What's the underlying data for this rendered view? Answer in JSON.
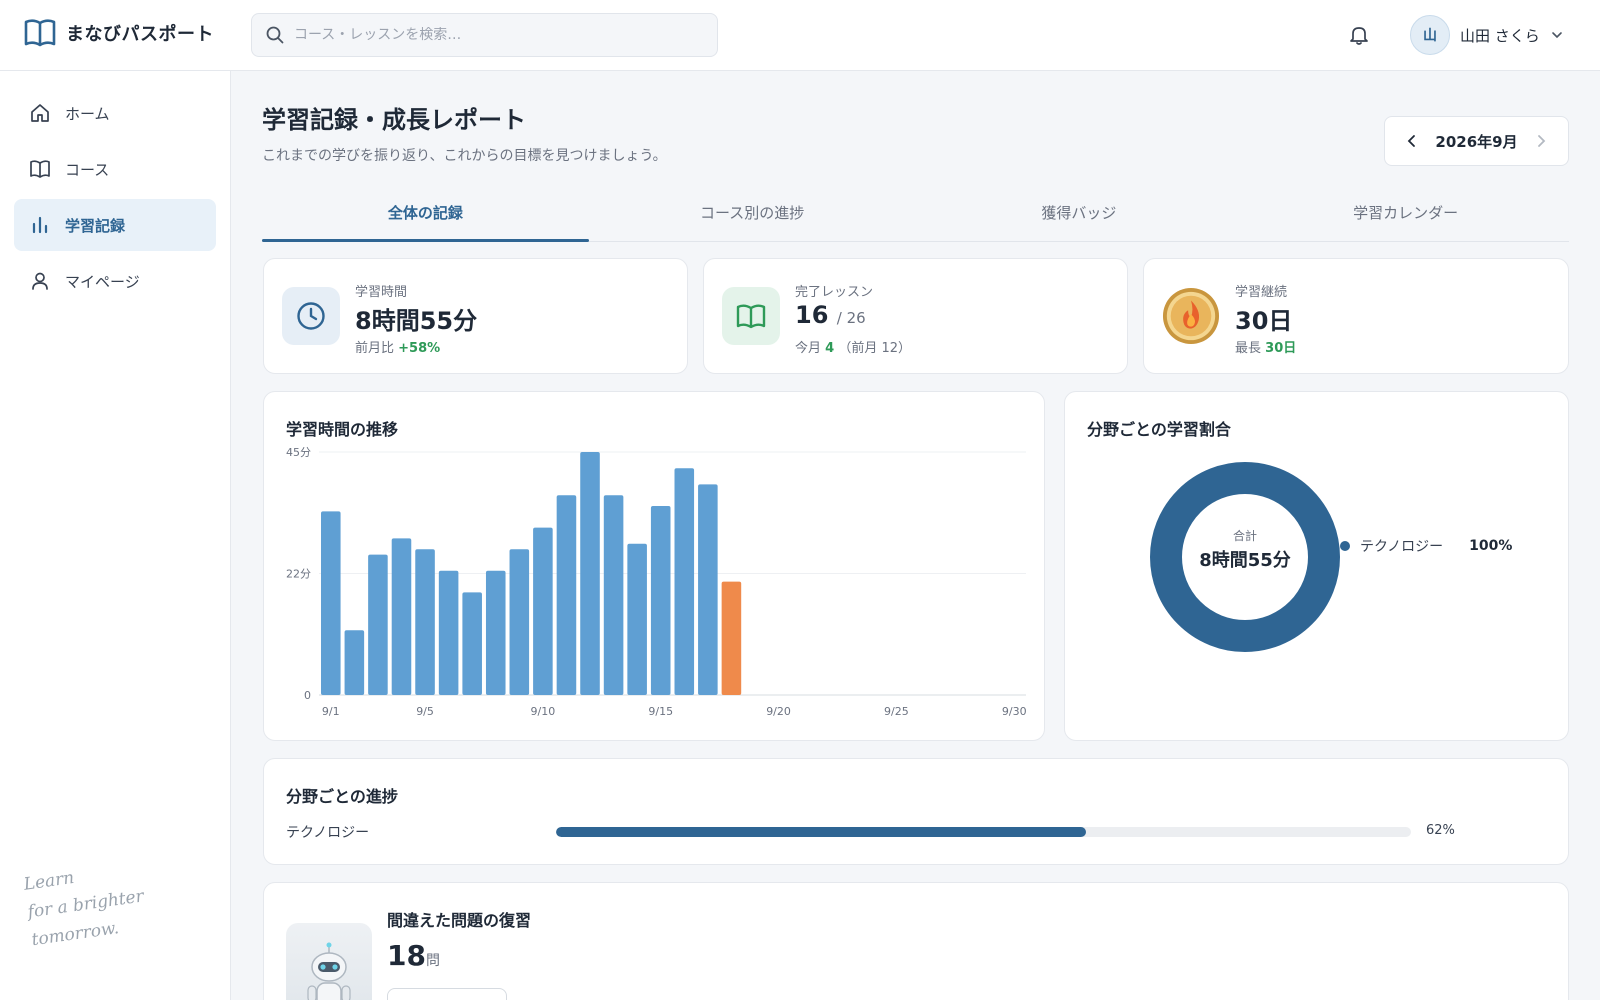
{
  "app": {
    "name": "まなびパスポート"
  },
  "search": {
    "placeholder": "コース・レッスンを検索…"
  },
  "user": {
    "avatar": "山",
    "name": "山田 さくら"
  },
  "sidebar": {
    "items": [
      {
        "label": "ホーム",
        "icon": "home-icon",
        "active": false
      },
      {
        "label": "コース",
        "icon": "book-icon",
        "active": false
      },
      {
        "label": "学習記録",
        "icon": "bar-chart-icon",
        "active": true
      },
      {
        "label": "マイページ",
        "icon": "user-icon",
        "active": false
      }
    ],
    "tagline_lines": [
      "Learn",
      "for a brighter",
      "tomorrow."
    ]
  },
  "page": {
    "title": "学習記録・成長レポート",
    "subtitle": "これまでの学びを振り返り、これからの目標を見つけましょう。",
    "month": "2026年9月"
  },
  "tabs": [
    {
      "label": "全体の記録",
      "active": true
    },
    {
      "label": "コース別の進捗",
      "active": false
    },
    {
      "label": "獲得バッジ",
      "active": false
    },
    {
      "label": "学習カレンダー",
      "active": false
    }
  ],
  "stats": {
    "time": {
      "label": "学習時間",
      "value": "8時間55分",
      "note_prefix": "前月比",
      "note_value": "+58%"
    },
    "lessons": {
      "label": "完了レッスン",
      "value": "16",
      "total": "/ 26",
      "note_prefix": "今月",
      "note_value": "4",
      "note_suffix": "（前月 12）"
    },
    "streak": {
      "label": "学習継続",
      "value": "30日",
      "note_prefix": "最長",
      "note_value": "30日"
    }
  },
  "colors": {
    "primary": "#2f6593",
    "bar": "#5f9fd3",
    "bar_today": "#ef8a4b",
    "positive": "#2e9a58"
  },
  "chart_data": [
    {
      "type": "bar",
      "title": "学習時間の推移",
      "x": [
        1,
        2,
        3,
        4,
        5,
        6,
        7,
        8,
        9,
        10,
        11,
        12,
        13,
        14,
        15,
        16,
        17,
        18
      ],
      "values": [
        34,
        12,
        26,
        29,
        27,
        23,
        19,
        23,
        27,
        31,
        37,
        45,
        37,
        28,
        35,
        42,
        39,
        21
      ],
      "highlight_index": 17,
      "xlim": [
        1,
        30
      ],
      "x_ticks": [
        "9/1",
        "9/5",
        "9/10",
        "9/15",
        "9/20",
        "9/25",
        "9/30"
      ],
      "x_tick_values": [
        1,
        5,
        10,
        15,
        20,
        25,
        30
      ],
      "ylim": [
        0,
        45
      ],
      "y_ticks": [
        "0",
        "22分",
        "45分"
      ],
      "y_tick_values": [
        0,
        22.5,
        45
      ],
      "grid": true
    },
    {
      "type": "pie",
      "title": "分野ごとの学習割合",
      "center_label": "合計",
      "center_value": "8時間55分",
      "slices": [
        {
          "name": "テクノロジー",
          "value": 100,
          "label": "100%"
        }
      ],
      "legend_position": "right"
    }
  ],
  "progress": {
    "title": "分野ごとの進捗",
    "items": [
      {
        "label": "テクノロジー",
        "value": 62,
        "display": "62%"
      }
    ]
  },
  "review": {
    "title": "間違えた問題の復習",
    "count": "18",
    "unit": "問"
  }
}
